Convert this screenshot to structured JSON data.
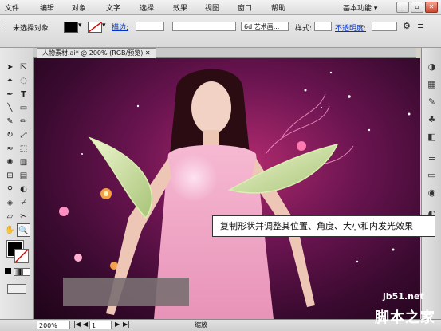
{
  "menu": {
    "items": [
      {
        "label": "文件"
      },
      {
        "label": "编辑"
      },
      {
        "label": "对象"
      },
      {
        "label": "文字"
      },
      {
        "label": "选择"
      },
      {
        "label": "效果"
      },
      {
        "label": "视图"
      },
      {
        "label": "窗口"
      },
      {
        "label": "帮助"
      }
    ],
    "workspace": "基本功能"
  },
  "control_bar": {
    "selection_label": "未选择对象",
    "stroke_label": "描边:",
    "brush_value": "6d 艺术画...",
    "style_label": "样式:",
    "opacity_link": "不透明度:"
  },
  "document": {
    "tab_title": "人物素材.ai* @ 200% (RGB/预览)"
  },
  "status": {
    "zoom": "200%",
    "page": "1",
    "tool_label": "缩放"
  },
  "caption": "复制形状并调整其位置、角度、大小和内发光效果",
  "watermark": {
    "site": "jb51.net",
    "name": "脚本之家"
  },
  "colors": {
    "fill_swatch": "#000000",
    "stroke_swatch": "#ffffff",
    "accent_link": "#0033cc",
    "leaf_green": "#d4e6a6",
    "bg_magenta": "#6a1450"
  },
  "icons": {
    "tools": [
      "selection-tool-icon",
      "direct-selection-icon",
      "magic-wand-icon",
      "lasso-icon",
      "pen-tool-icon",
      "type-tool-icon",
      "line-tool-icon",
      "rectangle-tool-icon",
      "paintbrush-icon",
      "pencil-icon",
      "rotate-icon",
      "scale-icon",
      "warp-icon",
      "free-transform-icon",
      "symbol-sprayer-icon",
      "column-graph-icon",
      "mesh-icon",
      "gradient-icon",
      "eyedropper-icon",
      "blend-icon",
      "live-paint-icon",
      "slice-icon",
      "eraser-icon",
      "scissors-icon",
      "hand-tool-icon",
      "zoom-tool-icon"
    ],
    "panels": [
      "color-panel-icon",
      "swatches-icon",
      "brushes-icon",
      "symbols-icon",
      "graphic-styles-icon",
      "stroke-panel-icon",
      "gradient-panel-icon",
      "transparency-icon",
      "appearance-icon",
      "layers-icon"
    ]
  }
}
